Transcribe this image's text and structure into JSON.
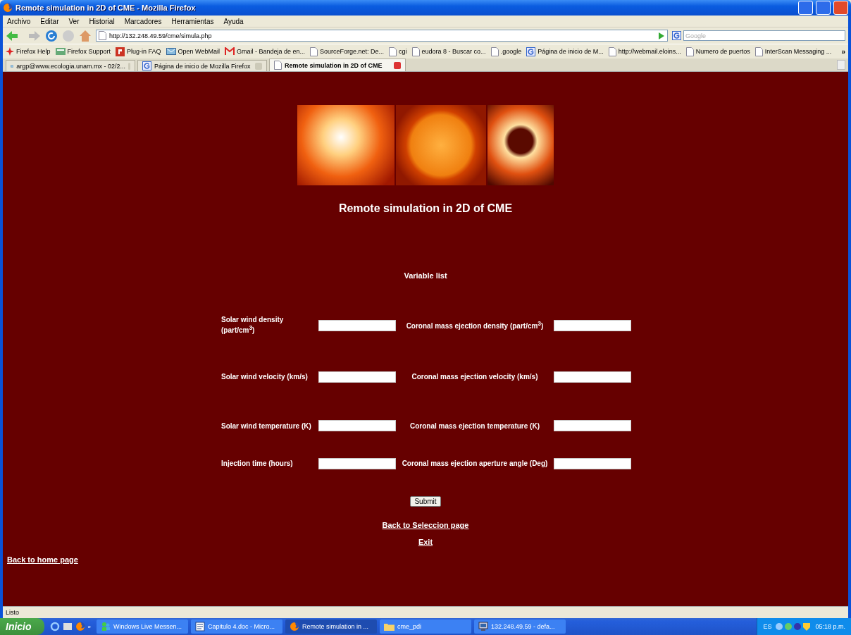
{
  "window": {
    "title": "Remote simulation in 2D of CME - Mozilla Firefox"
  },
  "menu": [
    "Archivo",
    "Editar",
    "Ver",
    "Historial",
    "Marcadores",
    "Herramientas",
    "Ayuda"
  ],
  "toolbar": {
    "url": "http://132.248.49.59/cme/simula.php",
    "search_placeholder": "Google"
  },
  "bookmarks": [
    {
      "label": "Firefox Help",
      "kind": "star"
    },
    {
      "label": "Firefox Support",
      "kind": "support"
    },
    {
      "label": "Plug-in FAQ",
      "kind": "plugin"
    },
    {
      "label": "Open WebMail",
      "kind": "mail"
    },
    {
      "label": "Gmail - Bandeja de en...",
      "kind": "gmail"
    },
    {
      "label": "SourceForge.net: De...",
      "kind": "page"
    },
    {
      "label": "cgi",
      "kind": "page"
    },
    {
      "label": "eudora 8 - Buscar co...",
      "kind": "page"
    },
    {
      "label": ".google",
      "kind": "page"
    },
    {
      "label": "Página de inicio de M...",
      "kind": "google"
    },
    {
      "label": "http://webmail.eloins...",
      "kind": "page"
    },
    {
      "label": "Numero de puertos",
      "kind": "page"
    },
    {
      "label": "InterScan Messaging ...",
      "kind": "page"
    }
  ],
  "bookmarks_more": "»",
  "tabs": [
    {
      "label": "argp@www.ecologia.unam.mx - 02/2...",
      "selected": false,
      "kind": "mail"
    },
    {
      "label": "Página de inicio de Mozilla Firefox",
      "selected": false,
      "kind": "google"
    },
    {
      "label": "Remote simulation in 2D of CME",
      "selected": true,
      "kind": "page"
    }
  ],
  "page": {
    "title": "Remote simulation in 2D of CME",
    "heading": "Variable list",
    "rows": [
      {
        "left": "Solar wind density (part/cm$^{3}$)",
        "right": "Coronal mass ejection density (part/cm$^{3}$)"
      },
      {
        "left": "Solar wind velocity (km/s)",
        "right": "Coronal mass ejection velocity (km/s)"
      },
      {
        "left": "Solar wind temperature (K)",
        "right": "Coronal mass ejection temperature (K)"
      },
      {
        "left": "Injection time (hours)",
        "right": "Coronal mass ejection aperture angle (Deg)"
      }
    ],
    "submit": "Submit",
    "links": [
      "Back to Seleccion page",
      "Exit"
    ],
    "home_link": "Back to home page"
  },
  "status_bar": "Listo",
  "taskbar": {
    "start": "Inicio",
    "quick_more": "»",
    "tasks": [
      {
        "label": "Windows Live Messen...",
        "selected": false,
        "kind": "messenger"
      },
      {
        "label": "Capitulo 4.doc - Micro...",
        "selected": false,
        "kind": "doc"
      },
      {
        "label": "Remote simulation in ...",
        "selected": true,
        "kind": "firefox"
      },
      {
        "label": "cme_pdi",
        "selected": false,
        "kind": "folder"
      },
      {
        "label": "132.248.49.59 - defa...",
        "selected": false,
        "kind": "remote"
      }
    ],
    "language": "ES",
    "clock": "05:18 p.m."
  }
}
